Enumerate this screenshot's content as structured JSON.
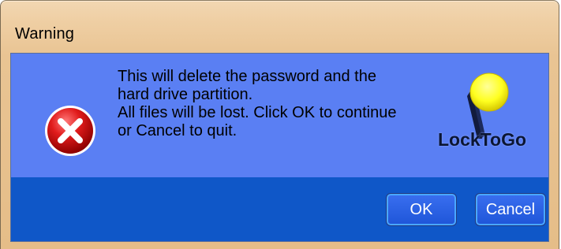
{
  "window": {
    "title": "Warning"
  },
  "dialog": {
    "icon": "error-x-icon",
    "message_lines": [
      "This will delete the password and the",
      "hard drive partition.",
      "All files will be lost. Click OK to continue",
      "or Cancel to quit."
    ],
    "logo_text": "LockToGo"
  },
  "buttons": {
    "ok_label": "OK",
    "cancel_label": "Cancel"
  },
  "colors": {
    "title_bar": "#efcfa4",
    "upper_panel": "#5a7ff3",
    "lower_panel": "#0f57c8",
    "button": "#1e55d8",
    "error_icon": "#d11a1a",
    "logo_ball": "#ffff33"
  }
}
